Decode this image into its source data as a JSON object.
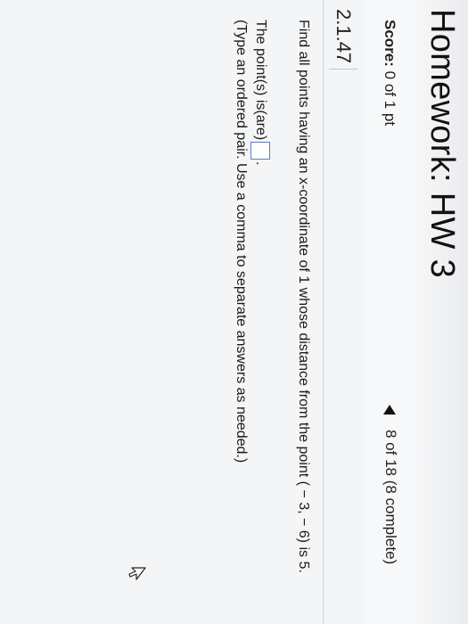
{
  "header": {
    "title": "Homework: HW 3"
  },
  "score_bar": {
    "score_label": "Score:",
    "score_value": "0 of 1 pt",
    "progress_text": "8 of 18 (8 complete)",
    "prev_icon": "left-triangle-icon"
  },
  "question": {
    "number": "2.1.47",
    "prompt": "Find all points having an x-coordinate of 1 whose distance from the point ( − 3, − 6) is 5.",
    "answer_prefix": "The point(s) is(are)",
    "answer_value": "",
    "answer_suffix": ".",
    "instructions": "(Type an ordered pair. Use a comma to separate answers as needed.)"
  },
  "cursor_icon": "mouse-pointer-icon",
  "colors": {
    "accent_border": "#5a7fbf",
    "text": "#222222",
    "background": "#f4f5f7"
  }
}
